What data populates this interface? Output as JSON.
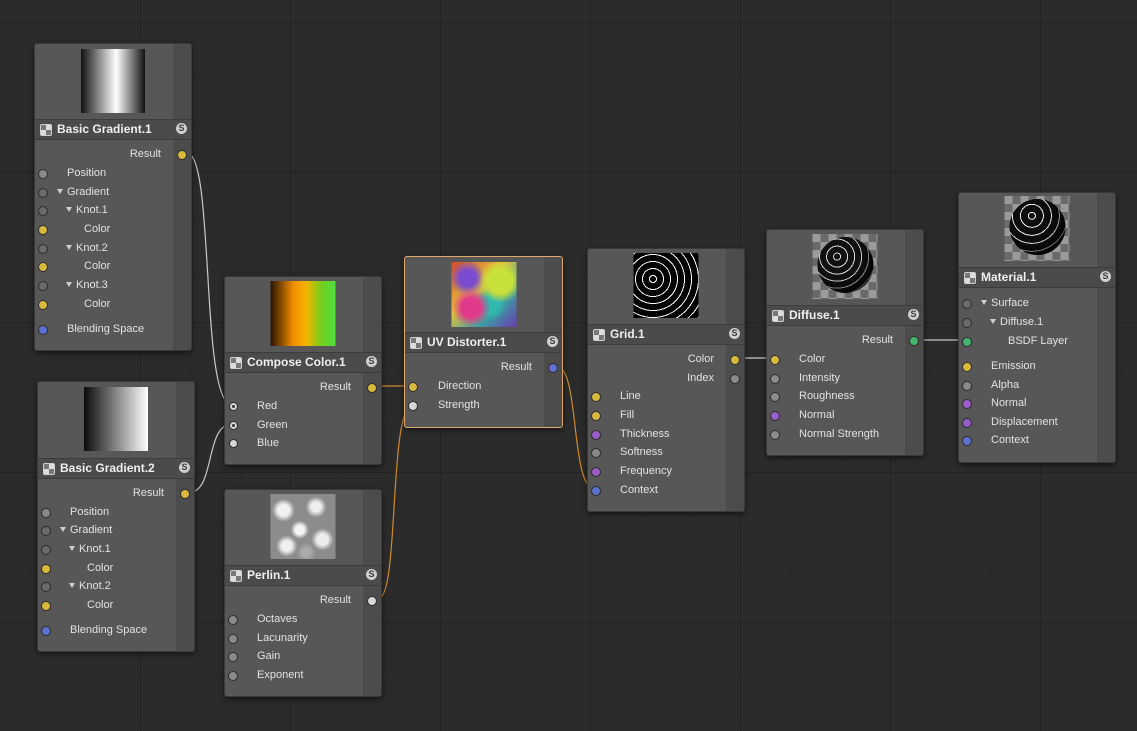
{
  "nodes": {
    "bg1": {
      "title": "Basic Gradient.1",
      "result": "Result",
      "inputs": [
        "Position",
        "Gradient",
        "Knot.1",
        "Color",
        "Knot.2",
        "Color",
        "Knot.3",
        "Color",
        "Blending Space"
      ]
    },
    "bg2": {
      "title": "Basic Gradient.2",
      "result": "Result",
      "inputs": [
        "Position",
        "Gradient",
        "Knot.1",
        "Color",
        "Knot.2",
        "Color",
        "Blending Space"
      ]
    },
    "compose": {
      "title": "Compose Color.1",
      "result": "Result",
      "inputs": [
        "Red",
        "Green",
        "Blue"
      ]
    },
    "perlin": {
      "title": "Perlin.1",
      "result": "Result",
      "inputs": [
        "Octaves",
        "Lacunarity",
        "Gain",
        "Exponent"
      ]
    },
    "uvd": {
      "title": "UV Distorter.1",
      "result": "Result",
      "inputs": [
        "Direction",
        "Strength"
      ]
    },
    "grid": {
      "title": "Grid.1",
      "outputs": [
        "Color",
        "Index"
      ],
      "inputs": [
        "Line",
        "Fill",
        "Thickness",
        "Softness",
        "Frequency",
        "Context"
      ]
    },
    "diffuse": {
      "title": "Diffuse.1",
      "result": "Result",
      "inputs": [
        "Color",
        "Intensity",
        "Roughness",
        "Normal",
        "Normal Strength"
      ]
    },
    "material": {
      "title": "Material.1",
      "inputs": [
        "Surface",
        "Diffuse.1",
        "BSDF Layer",
        "Emission",
        "Alpha",
        "Normal",
        "Displacement",
        "Context"
      ]
    }
  },
  "solo_label": "S",
  "colors": {
    "wire": "#c9c9c9",
    "wire_orange": "#d08a2c",
    "selected": "#e0a968"
  },
  "icons": [
    "node-type-icon",
    "solo-icon",
    "expand-triangle-icon"
  ]
}
